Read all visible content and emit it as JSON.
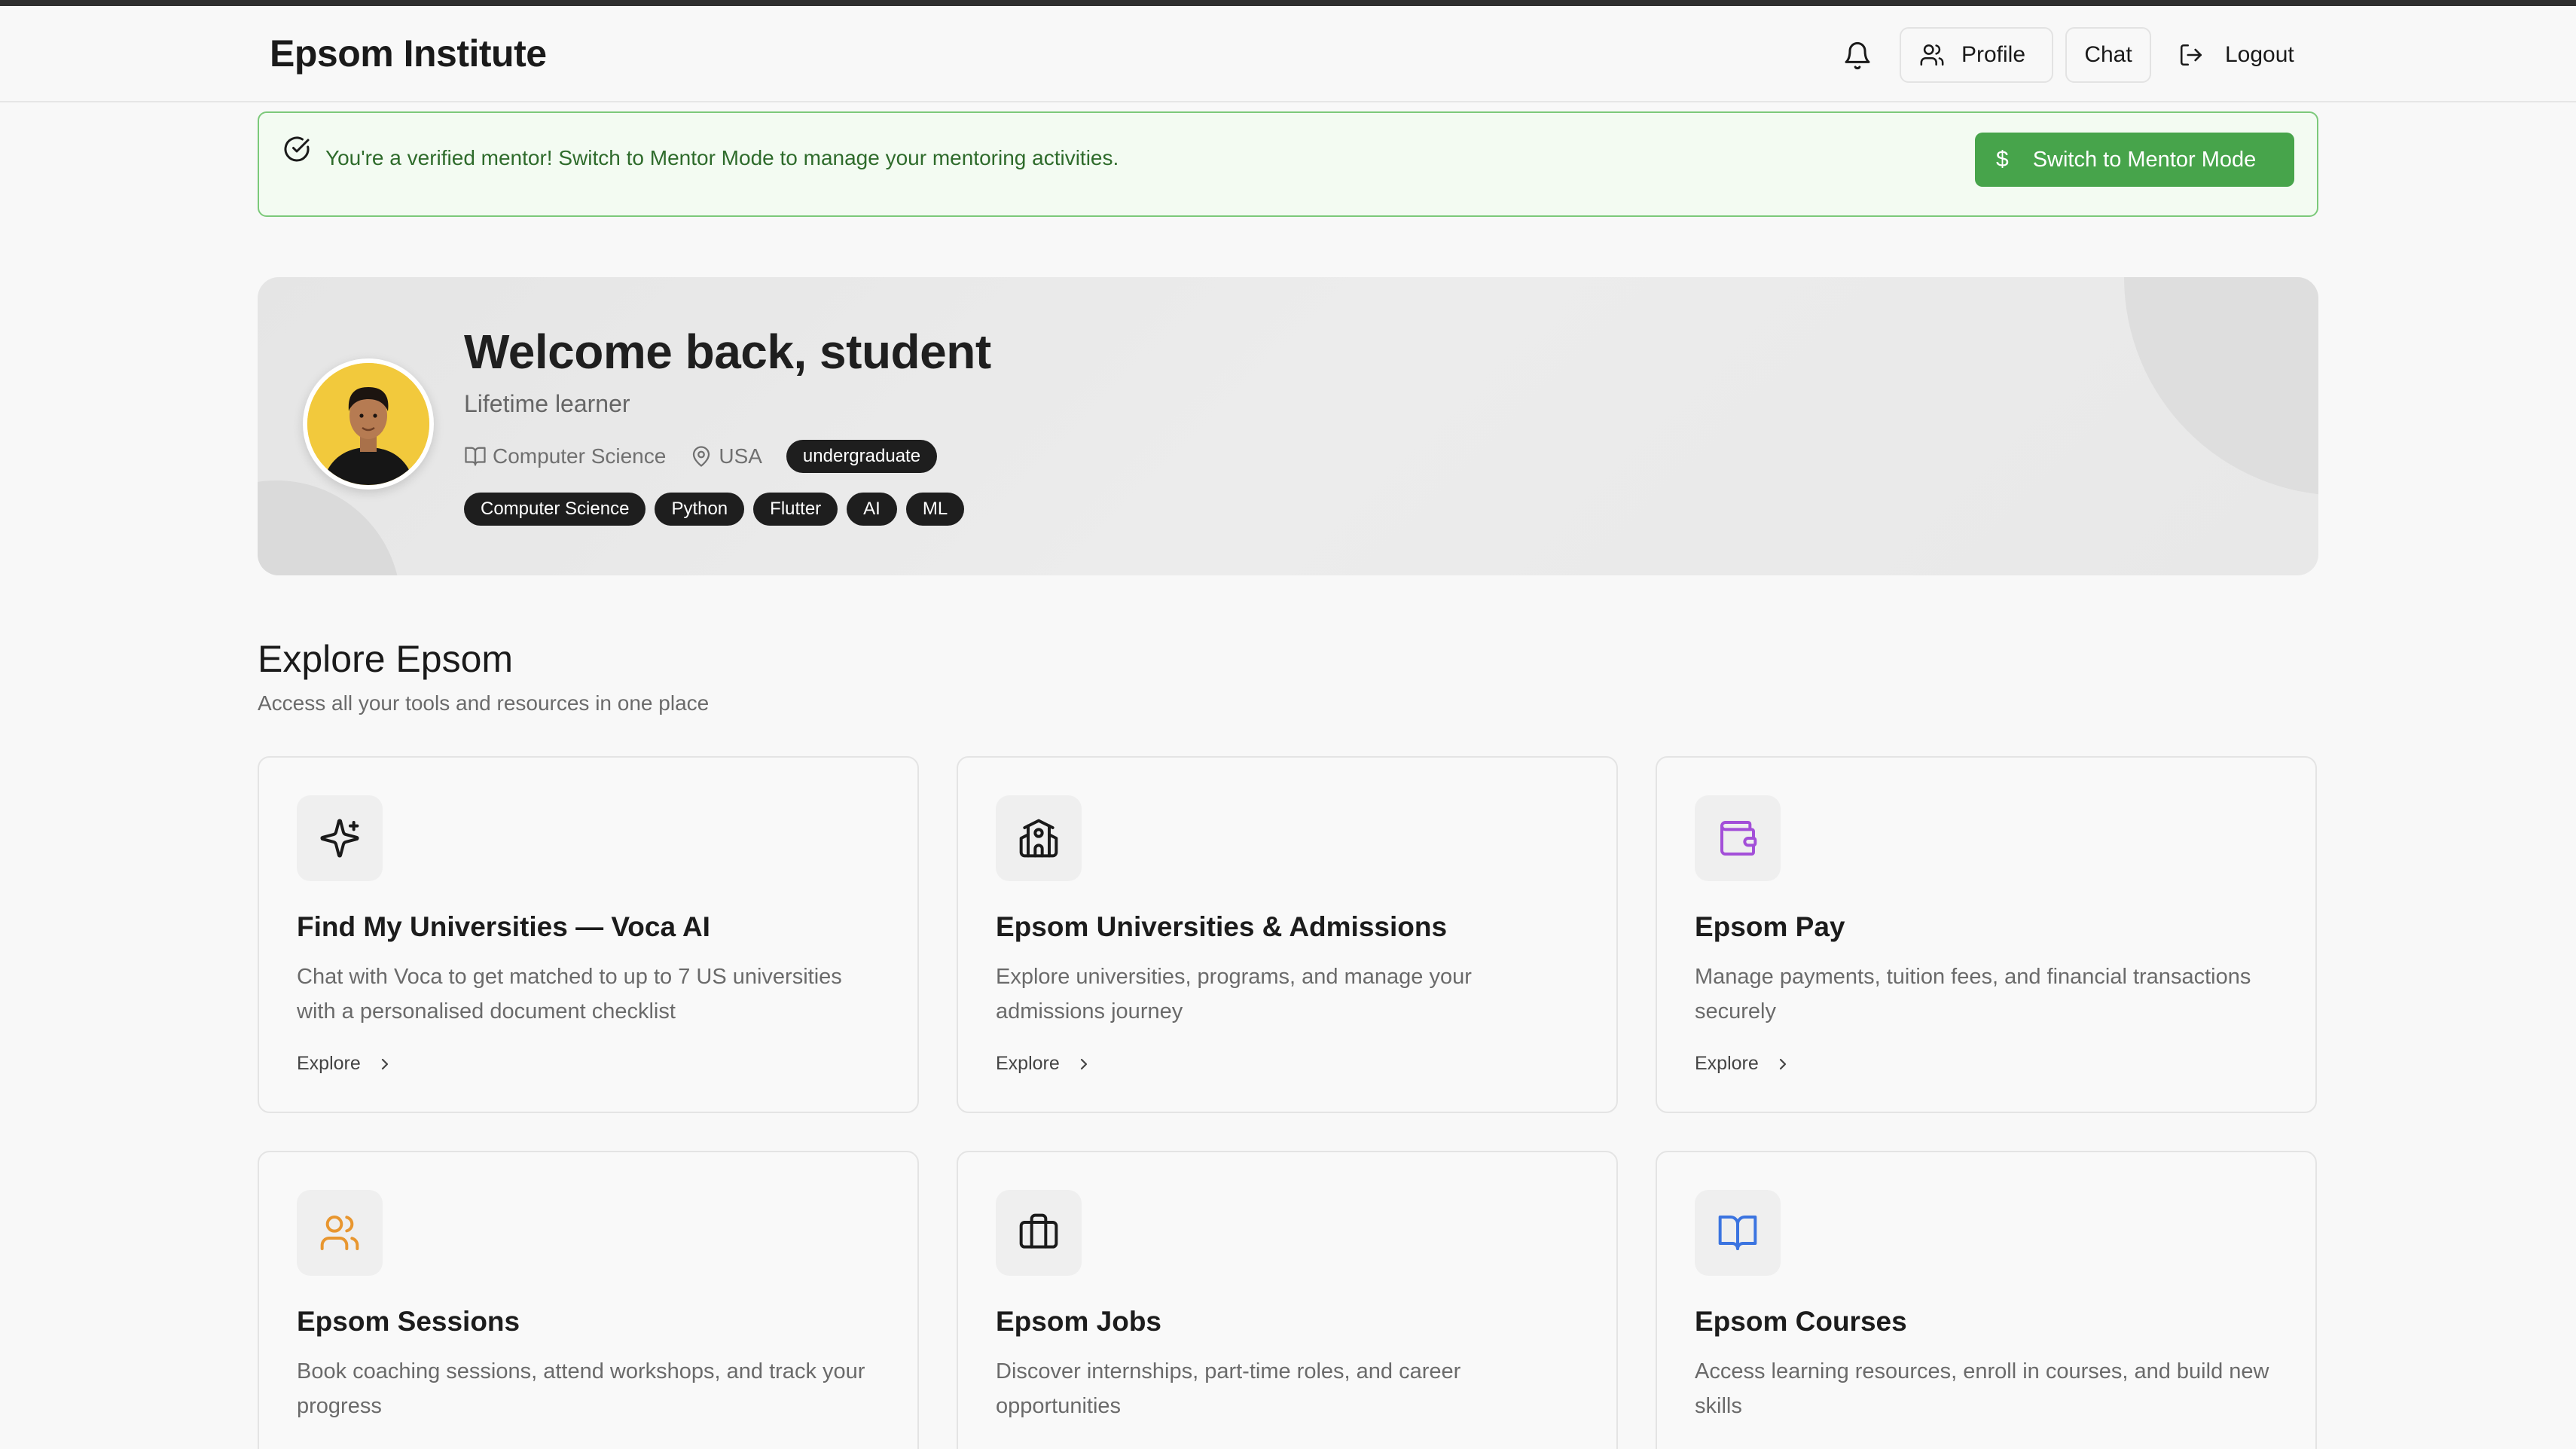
{
  "header": {
    "brand": "Epsom Institute",
    "profile_label": "Profile",
    "chat_label": "Chat",
    "logout_label": "Logout"
  },
  "mentor_banner": {
    "message": "You're a verified mentor! Switch to Mentor Mode to manage your mentoring activities.",
    "button_label": "Switch to Mentor Mode",
    "button_icon": "$"
  },
  "hero": {
    "title": "Welcome back, student",
    "subtitle": "Lifetime learner",
    "field": "Computer Science",
    "location": "USA",
    "level": "undergraduate",
    "tags": [
      "Computer Science",
      "Python",
      "Flutter",
      "AI",
      "ML"
    ]
  },
  "explore": {
    "title": "Explore Epsom",
    "subtitle": "Access all your tools and resources in one place",
    "cards": [
      {
        "title": "Find My Universities — Voca AI",
        "desc": "Chat with Voca to get matched to up to 7 US universities with a personalised document checklist",
        "link": "Explore",
        "icon": "sparkles-icon",
        "color": "#1a1a1a"
      },
      {
        "title": "Epsom Universities & Admissions",
        "desc": "Explore universities, programs, and manage your admissions journey",
        "link": "Explore",
        "icon": "school-icon",
        "color": "#1a1a1a"
      },
      {
        "title": "Epsom Pay",
        "desc": "Manage payments, tuition fees, and financial transactions securely",
        "link": "Explore",
        "icon": "wallet-icon",
        "color": "#a34fd8"
      },
      {
        "title": "Epsom Sessions",
        "desc": "Book coaching sessions, attend workshops, and track your progress",
        "link": "",
        "icon": "users-icon",
        "color": "#e8962f"
      },
      {
        "title": "Epsom Jobs",
        "desc": "Discover internships, part-time roles, and career opportunities",
        "link": "",
        "icon": "briefcase-icon",
        "color": "#1a1a1a"
      },
      {
        "title": "Epsom Courses",
        "desc": "Access learning resources, enroll in courses, and build new skills",
        "link": "",
        "icon": "book-open-icon",
        "color": "#3b74e0"
      }
    ]
  }
}
